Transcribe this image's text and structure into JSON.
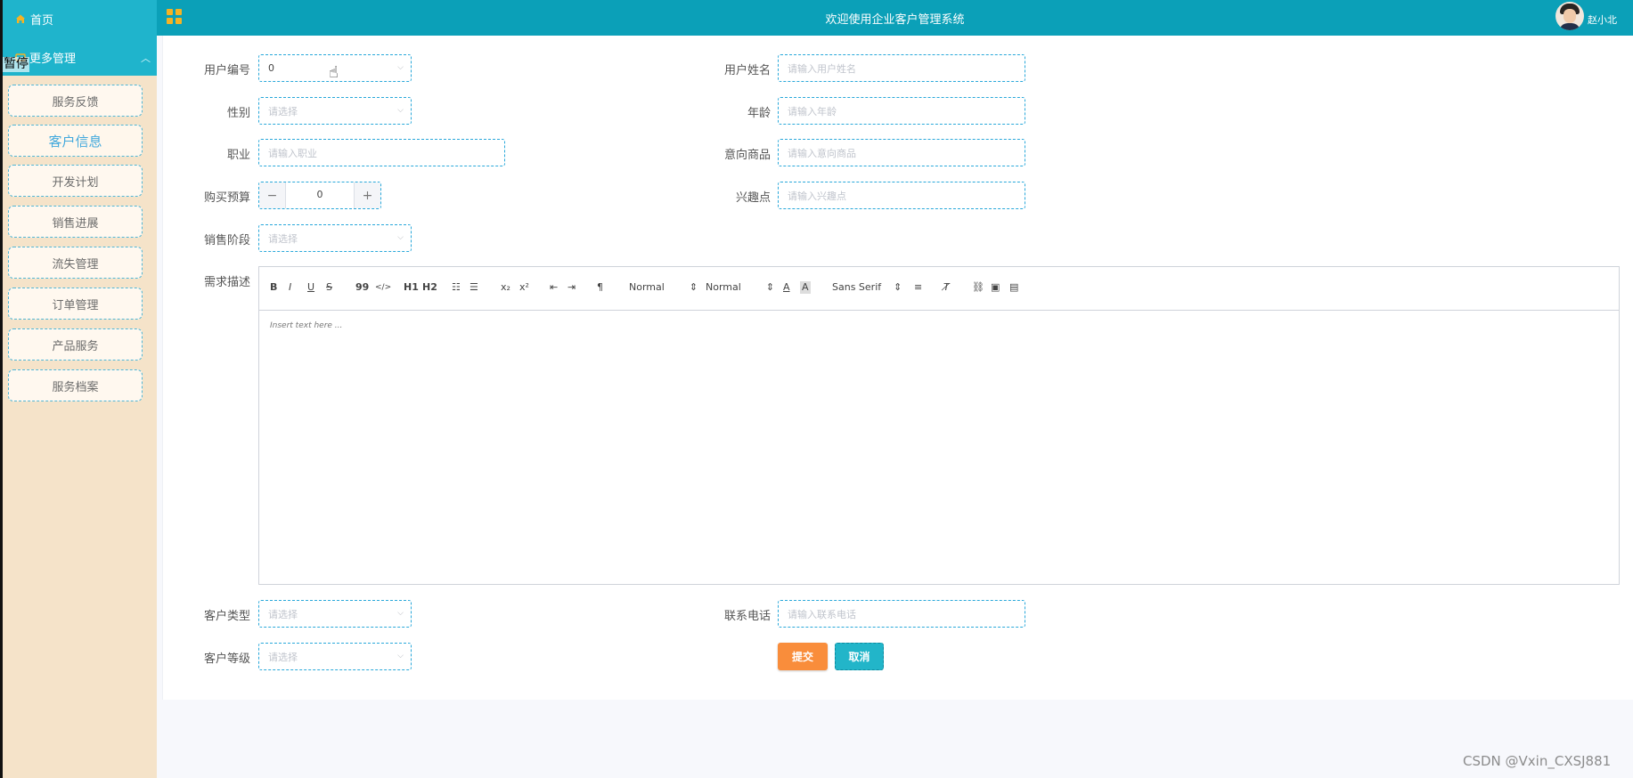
{
  "header": {
    "title": "欢迎使用企业客户管理系统",
    "username": "赵小北"
  },
  "sidebar": {
    "home_label": "首页",
    "more_label": "更多管理",
    "overlay_text": "暂停",
    "items": [
      {
        "label": "服务反馈"
      },
      {
        "label": "客户信息"
      },
      {
        "label": "开发计划"
      },
      {
        "label": "销售进展"
      },
      {
        "label": "流失管理"
      },
      {
        "label": "订单管理"
      },
      {
        "label": "产品服务"
      },
      {
        "label": "服务档案"
      }
    ]
  },
  "form": {
    "user_id": {
      "label": "用户编号",
      "value": "0"
    },
    "user_name": {
      "label": "用户姓名",
      "placeholder": "请输入用户姓名"
    },
    "gender": {
      "label": "性别",
      "placeholder": "请选择"
    },
    "age": {
      "label": "年龄",
      "placeholder": "请输入年龄"
    },
    "job": {
      "label": "职业",
      "placeholder": "请输入职业"
    },
    "intended_goods": {
      "label": "意向商品",
      "placeholder": "请输入意向商品"
    },
    "budget": {
      "label": "购买预算",
      "value": "0"
    },
    "interest": {
      "label": "兴趣点",
      "placeholder": "请输入兴趣点"
    },
    "sales_stage": {
      "label": "销售阶段",
      "placeholder": "请选择"
    },
    "requirement": {
      "label": "需求描述",
      "placeholder": "Insert text here ..."
    },
    "customer_type": {
      "label": "客户类型",
      "placeholder": "请选择"
    },
    "phone": {
      "label": "联系电话",
      "placeholder": "请输入联系电话"
    },
    "customer_level": {
      "label": "客户等级",
      "placeholder": "请选择"
    }
  },
  "editor_toolbar": {
    "bold": "B",
    "italic": "I",
    "underline": "U",
    "strike": "S",
    "quote": "99",
    "code": "</>",
    "h1": "H1",
    "h2": "H2",
    "sub": "x₂",
    "sup": "x²",
    "size1": "Normal",
    "size2": "Normal",
    "font": "Sans Serif"
  },
  "actions": {
    "submit": "提交",
    "cancel": "取消"
  },
  "watermark": "CSDN @Vxin_CXSJ881",
  "colors": {
    "header": "#0ba0b8",
    "sidebar": "#f5e3c9",
    "submit": "#f98d3b",
    "cancel": "#22b5c9"
  }
}
